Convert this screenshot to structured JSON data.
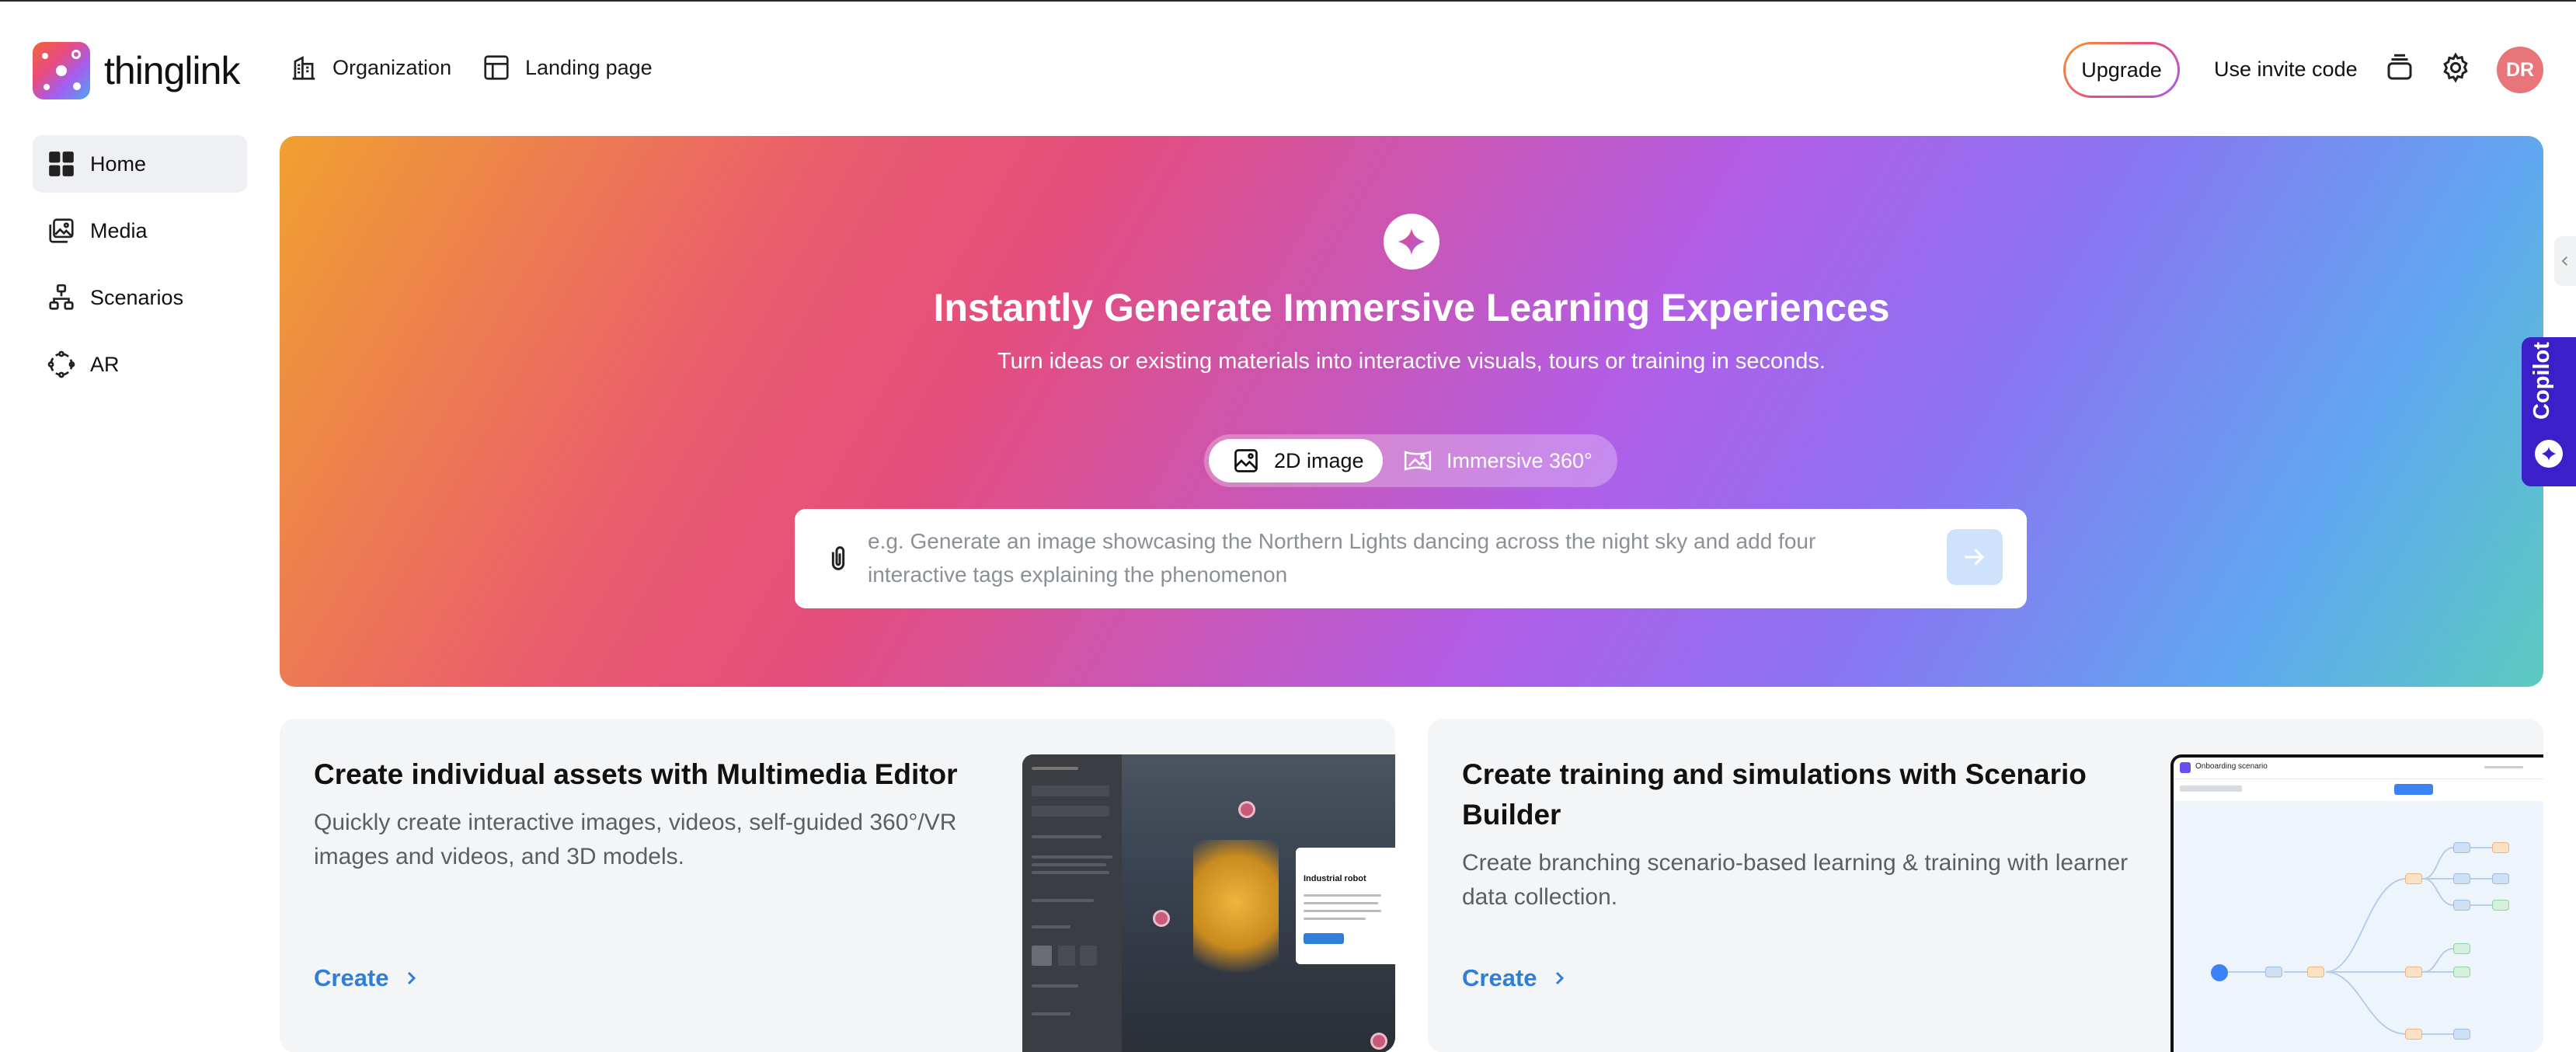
{
  "brand": {
    "name": "thinglink"
  },
  "header": {
    "nav": [
      {
        "label": "Organization",
        "icon": "building-icon"
      },
      {
        "label": "Landing page",
        "icon": "layout-icon"
      }
    ],
    "upgrade_label": "Upgrade",
    "invite_label": "Use invite code",
    "avatar_initials": "DR",
    "colors": {
      "upgrade_gradient": [
        "#f59a2e",
        "#e94c7a",
        "#a45cf0"
      ],
      "avatar": "#e8757a"
    }
  },
  "sidebar": {
    "items": [
      {
        "label": "Home",
        "icon": "grid-icon",
        "active": true
      },
      {
        "label": "Media",
        "icon": "images-icon",
        "active": false
      },
      {
        "label": "Scenarios",
        "icon": "flow-icon",
        "active": false
      },
      {
        "label": "AR",
        "icon": "ar-icon",
        "active": false
      }
    ]
  },
  "hero": {
    "title": "Instantly Generate Immersive Learning Experiences",
    "subtitle": "Turn ideas or existing materials into interactive visuals, tours or training in seconds.",
    "modes": [
      {
        "label": "2D image",
        "selected": true
      },
      {
        "label": "Immersive 360°",
        "selected": false
      }
    ],
    "prompt_placeholder": "e.g. Generate an image showcasing the Northern Lights dancing across the night sky and add four interactive tags explaining the phenomenon",
    "colors": {
      "gradient": [
        "#f0a030",
        "#e54d7c",
        "#b15ee8",
        "#5fa9ef",
        "#5ccabf"
      ],
      "send_button": "#cfe2fb"
    }
  },
  "copilot": {
    "label": "Copilot",
    "color": "#3b1fc8"
  },
  "cards": [
    {
      "title": "Create individual assets with Multimedia Editor",
      "description": "Quickly create interactive images, videos, self-guided 360°/VR images and videos, and 3D models.",
      "link_label": "Create",
      "preview_label": "Industrial robot"
    },
    {
      "title": "Create training and simulations with Scenario Builder",
      "description": "Create branching scenario-based learning & training with learner data collection.",
      "link_label": "Create",
      "preview_label": "Onboarding scenario"
    }
  ],
  "colors": {
    "link": "#2f7fd8",
    "card_bg": "#f4f5f7",
    "active_nav_bg": "#eef0f3"
  }
}
